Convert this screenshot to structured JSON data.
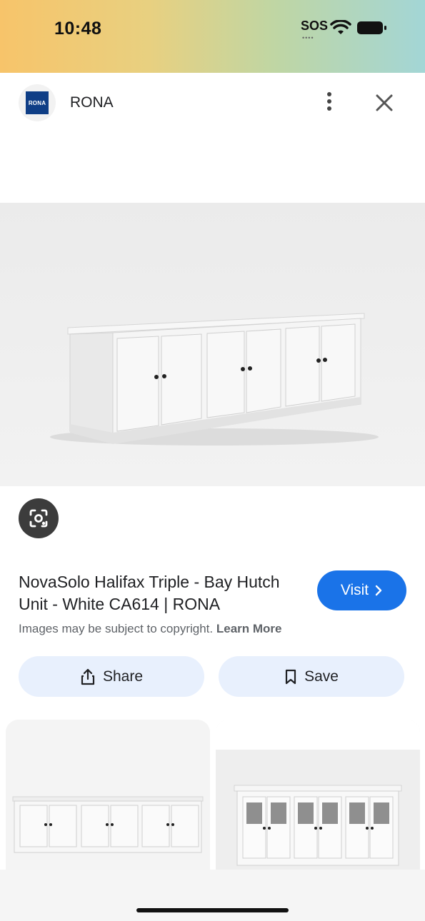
{
  "status": {
    "time": "10:48",
    "sos": "SOS"
  },
  "header": {
    "brand": "RONA",
    "logo_text": "RONA"
  },
  "product": {
    "title": "NovaSolo Halifax Triple - Bay Hutch Unit - White CA614 | RONA",
    "visit_label": "Visit",
    "copyright_text": "Images may be subject to copyright.",
    "learn_more": "Learn More"
  },
  "actions": {
    "share_label": "Share",
    "save_label": "Save"
  },
  "icons": {
    "more": "more-vert-icon",
    "close": "close-icon",
    "lens": "lens-icon",
    "share": "share-icon",
    "save": "bookmark-icon",
    "chevron": "chevron-right-icon"
  },
  "colors": {
    "accent": "#1a73e8",
    "pill": "#e8f0fd",
    "rona_blue": "#0f3e86"
  }
}
